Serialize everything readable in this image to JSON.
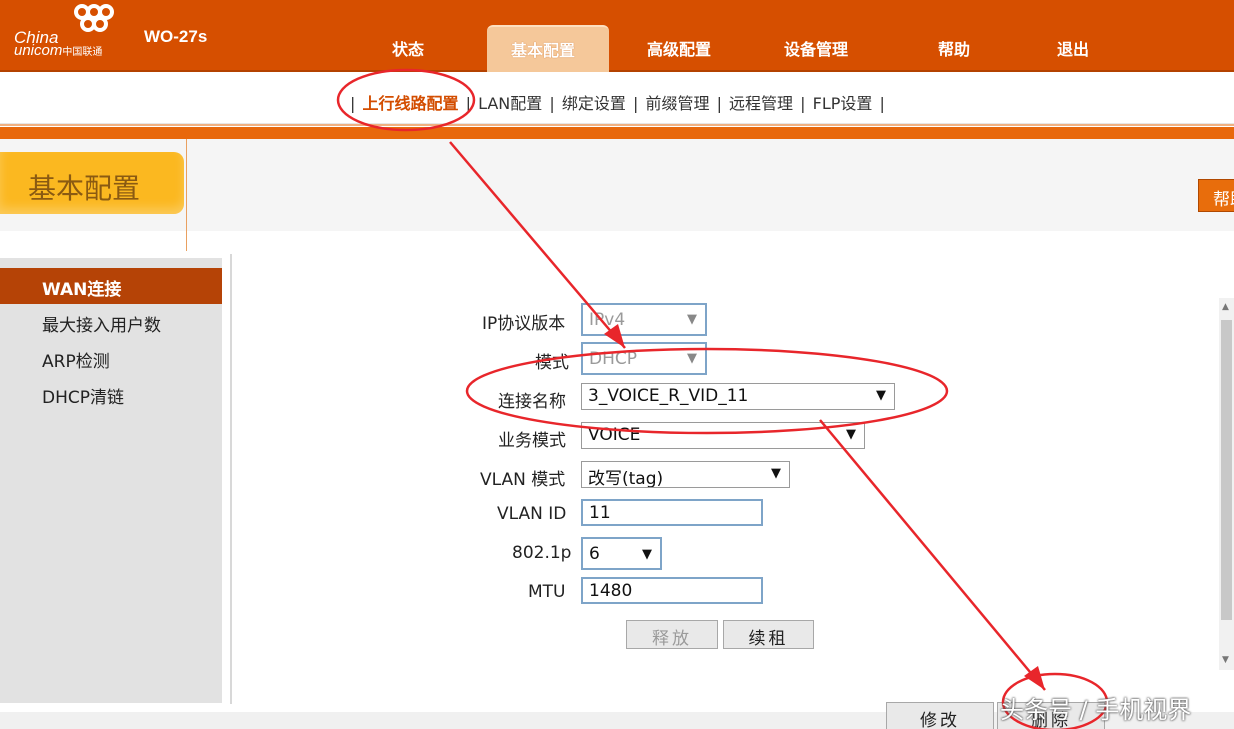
{
  "header": {
    "brand_line1": "China",
    "brand_line2": "unicom",
    "brand_line2_cn": "中国联通",
    "model": "WO-27s",
    "nav": [
      "状态",
      "基本配置",
      "高级配置",
      "设备管理",
      "帮助",
      "退出"
    ],
    "nav_active": "基本配置"
  },
  "subnav": {
    "items": [
      "上行线路配置",
      "LAN配置",
      "绑定设置",
      "前缀管理",
      "远程管理",
      "FLP设置"
    ],
    "active": "上行线路配置",
    "separator": "|"
  },
  "page": {
    "title": "基本配置",
    "help_label": "帮助"
  },
  "sidebar": {
    "items": [
      "WAN连接",
      "最大接入用户数",
      "ARP检测",
      "DHCP清链"
    ],
    "active": "WAN连接"
  },
  "form": {
    "ip_version": {
      "label": "IP协议版本",
      "value": "IPv4"
    },
    "mode": {
      "label": "模式",
      "value": "DHCP"
    },
    "connection_name": {
      "label": "连接名称",
      "value": "3_VOICE_R_VID_11"
    },
    "service_mode": {
      "label": "业务模式",
      "value": "VOICE"
    },
    "vlan_mode": {
      "label": "VLAN 模式",
      "value": "改写(tag)"
    },
    "vlan_id": {
      "label": "VLAN ID",
      "value": "11"
    },
    "dot1p": {
      "label": "802.1p",
      "value": "6"
    },
    "mtu": {
      "label": "MTU",
      "value": "1480"
    },
    "release_label": "释放",
    "renew_label": "续租"
  },
  "footer_buttons": {
    "modify_label": "修改",
    "delete_label": "删除"
  },
  "watermark": "头条号 / 手机视界",
  "colors": {
    "header_orange": "#d64f00",
    "accent_orange": "#e8680c",
    "title_tab_yellow": "#fbb820",
    "sidebar_active": "#b54306",
    "annotation_red": "#e8262b"
  }
}
